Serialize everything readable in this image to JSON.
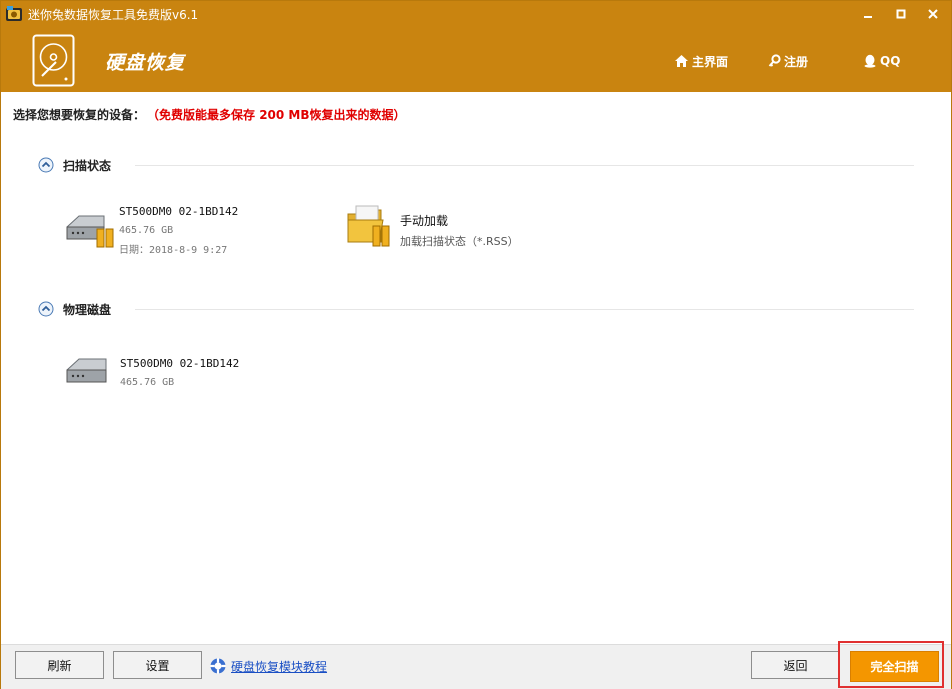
{
  "window": {
    "title": "迷你兔数据恢复工具免费版v6.1",
    "accent_color": "#c98410",
    "controls": [
      "minimize-icon",
      "maximize-icon",
      "close-icon"
    ]
  },
  "header": {
    "title": "硬盘恢复",
    "logo_icon": "hard-disk-logo-icon",
    "nav": [
      {
        "label": "主界面",
        "icon": "home-icon"
      },
      {
        "label": "注册",
        "icon": "key-icon"
      },
      {
        "label": "QQ",
        "icon": "qq-penguin-icon"
      }
    ]
  },
  "prompt": {
    "label": "选择您想要恢复的设备：",
    "notice": "（免费版能最多保存 200 MB恢复出来的数据）",
    "notice_color": "#e00000"
  },
  "scan_state": {
    "title": "扫描状态",
    "items": [
      {
        "name": "ST500DM0 02-1BD142",
        "size": "465.76 GB",
        "date": "日期：2018-8-9 9:27",
        "icon": "hard-disk-with-pause-icon"
      },
      {
        "name": "手动加载",
        "desc": "加载扫描状态（*.RSS）",
        "icon": "folder-with-pause-icon"
      }
    ]
  },
  "physical_disk": {
    "title": "物理磁盘",
    "items": [
      {
        "name": "ST500DM0 02-1BD142",
        "size": "465.76 GB",
        "icon": "hard-disk-icon"
      }
    ]
  },
  "footer": {
    "refresh": "刷新",
    "settings": "设置",
    "tutorial": "硬盘恢复模块教程",
    "back": "返回",
    "full_scan": "完全扫描",
    "full_scan_color": "#f49600"
  }
}
